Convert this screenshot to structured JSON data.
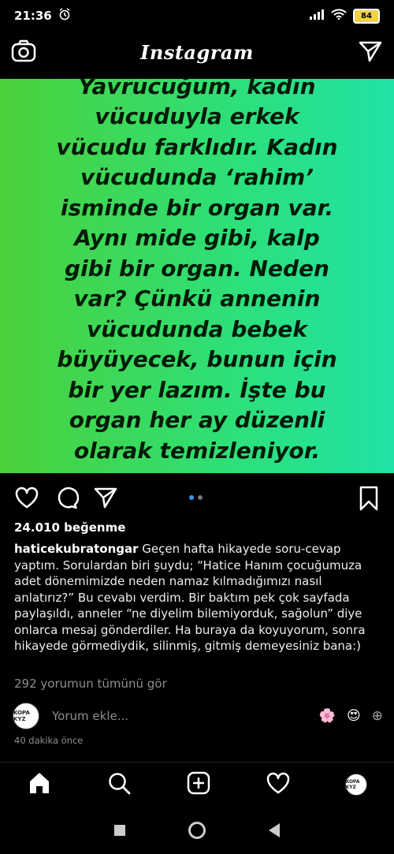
{
  "statusbar": {
    "time": "21:36",
    "signal": "....",
    "battery": "84"
  },
  "header": {
    "logo": "Instagram"
  },
  "post": {
    "image_text": "Yavrucuğum, kadın\nvücuduyla erkek\nvücudu farklıdır. Kadın\nvücudunda ‘rahim’\nisminde bir organ var.\nAynı mide gibi, kalp\ngibi bir organ. Neden\nvar? Çünkü annenin\nvücudunda bebek\nbüyüyecek, bunun için\nbir yer lazım. İşte bu\norgan her ay düzenli\nolarak temizleniyor.",
    "likes": "24.010 beğenme",
    "caption_user": "haticekubratongar",
    "caption_text": " Geçen hafta hikayede soru-cevap yaptım. Sorulardan biri şuydu; “Hatice Hanım çocuğumuza adet dönemimizde neden namaz kılmadığımızı nasıl anlatırız?” Bu cevabı verdim. Bir baktım pek çok sayfada paylaşıldı, anneler “ne diyelim bilemiyorduk, sağolun” diye onlarca mesaj gönderdiler. Ha buraya da koyuyorum, sonra hikayede görmediydik, silinmiş, gitmiş demeyesiniz bana:)",
    "comments_link": "292 yorumun tümünü gör",
    "add_comment_placeholder": "Yorum ekle...",
    "time_ago": "40 dakika önce",
    "avatar_text": "KOPA KYZ",
    "emoji_1": "🌸",
    "emoji_2": "😍",
    "emoji_3": "⊕"
  },
  "colors": {
    "accent_blue": "#3897f0",
    "gradient_start": "#4bd13a",
    "gradient_end": "#1fe2a6"
  }
}
